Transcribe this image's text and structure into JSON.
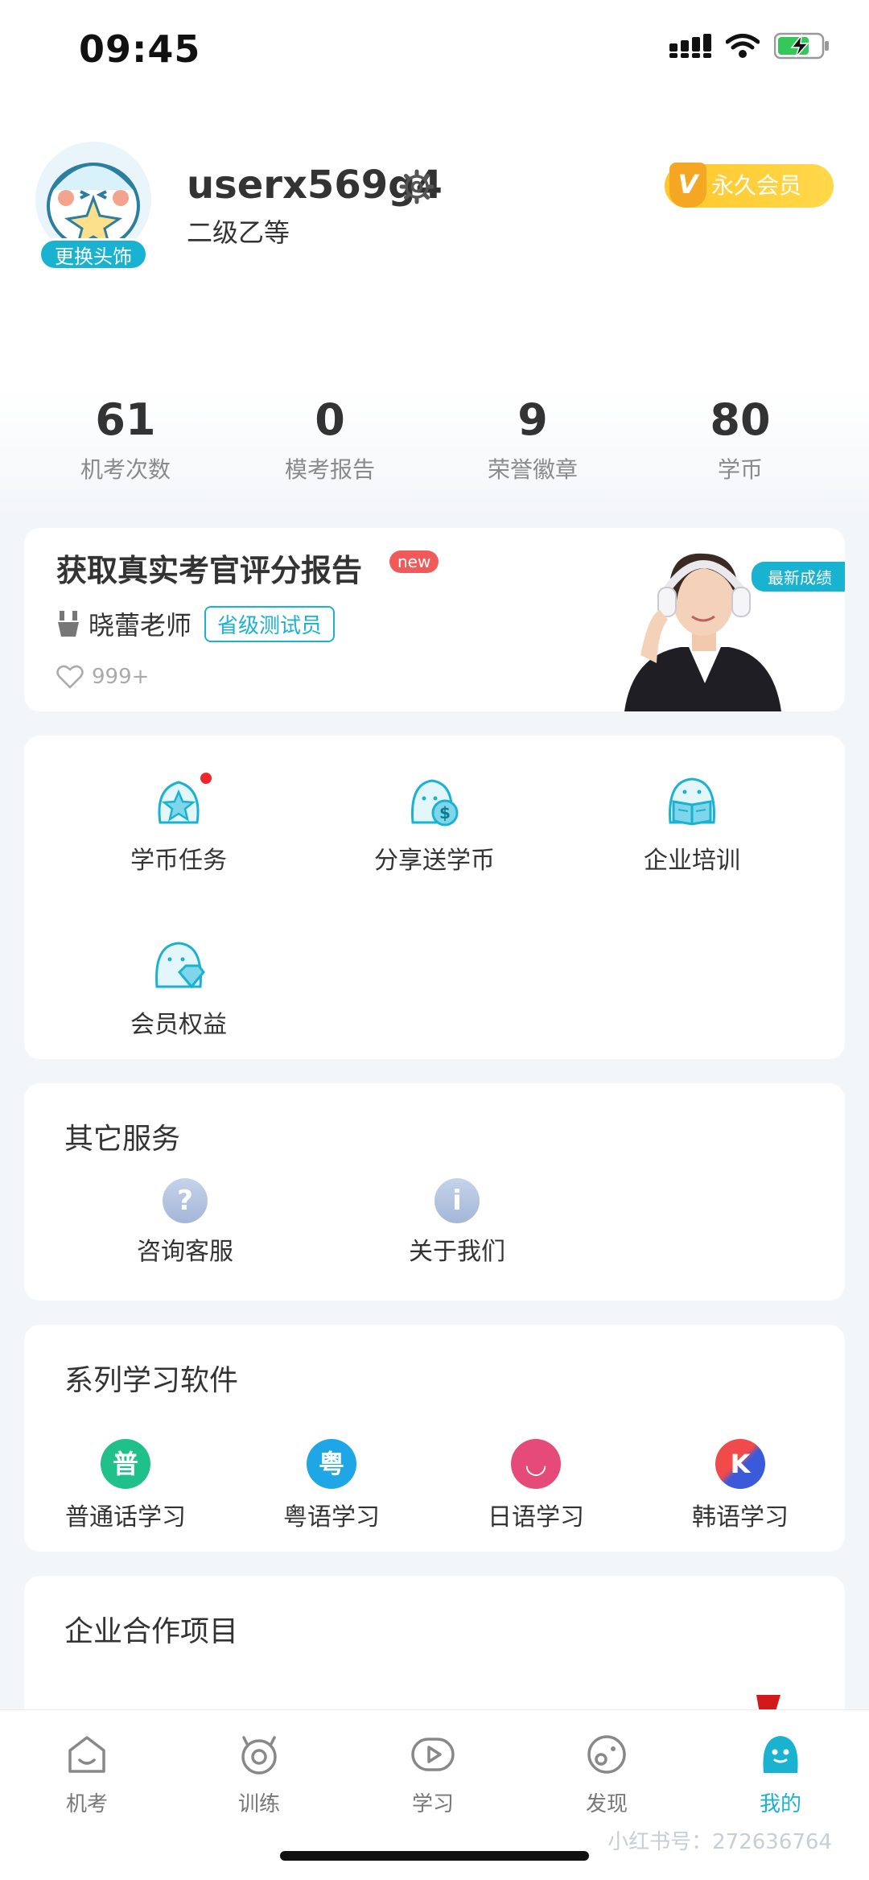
{
  "status_bar": {
    "time": "09:45"
  },
  "profile": {
    "username": "userx569g4",
    "level": "二级乙等",
    "avatar_badge": "更换头饰",
    "vip_label": "永久会员",
    "vip_letter": "V"
  },
  "stats": [
    {
      "value": "61",
      "label": "机考次数"
    },
    {
      "value": "0",
      "label": "模考报告"
    },
    {
      "value": "9",
      "label": "荣誉徽章"
    },
    {
      "value": "80",
      "label": "学币"
    }
  ],
  "report": {
    "title": "获取真实考官评分报告",
    "new_badge": "new",
    "teacher_name": "晓蕾老师",
    "teacher_tag": "省级测试员",
    "likes": "999+",
    "latest_badge": "最新成绩"
  },
  "functions": [
    {
      "label": "学币任务",
      "icon": "star-face-icon",
      "dot": true
    },
    {
      "label": "分享送学币",
      "icon": "coin-face-icon",
      "dot": false
    },
    {
      "label": "企业培训",
      "icon": "book-face-icon",
      "dot": false
    },
    {
      "label": "会员权益",
      "icon": "diamond-face-icon",
      "dot": false
    }
  ],
  "services": {
    "title": "其它服务",
    "items": [
      {
        "label": "咨询客服",
        "icon": "question-icon",
        "glyph": "?"
      },
      {
        "label": "关于我们",
        "icon": "info-icon",
        "glyph": "i"
      }
    ]
  },
  "apps": {
    "title": "系列学习软件",
    "items": [
      {
        "label": "普通话学习",
        "glyph": "普",
        "color": "#1fc08a"
      },
      {
        "label": "粤语学习",
        "glyph": "粤",
        "color": "#1ea6e6"
      },
      {
        "label": "日语学习",
        "glyph": "◡",
        "color": "#e64a78"
      },
      {
        "label": "韩语学习",
        "glyph": "K",
        "color": "#3a5ad9"
      }
    ]
  },
  "partners": {
    "title": "企业合作项目"
  },
  "tabs": [
    {
      "label": "机考",
      "icon": "home-icon",
      "active": false
    },
    {
      "label": "训练",
      "icon": "training-icon",
      "active": false
    },
    {
      "label": "学习",
      "icon": "play-icon",
      "active": false
    },
    {
      "label": "发现",
      "icon": "discover-icon",
      "active": false
    },
    {
      "label": "我的",
      "icon": "profile-icon",
      "active": true
    }
  ],
  "watermark": "小红书号：272636764",
  "colors": {
    "accent": "#19b3d1",
    "vip": "#ffc72c",
    "alert": "#f0262b"
  }
}
